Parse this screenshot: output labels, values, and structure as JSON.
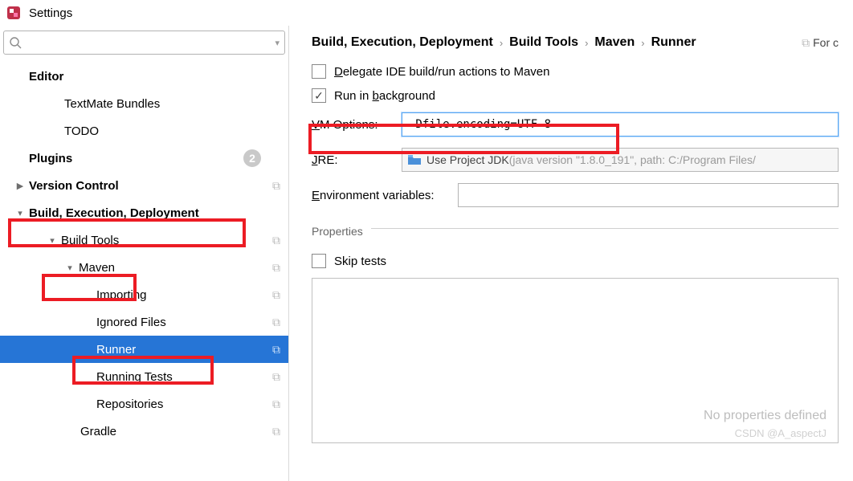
{
  "window": {
    "title": "Settings"
  },
  "search": {
    "placeholder": ""
  },
  "tree": {
    "editor": "Editor",
    "textmate": "TextMate Bundles",
    "todo": "TODO",
    "plugins": "Plugins",
    "plugins_badge": "2",
    "version_control": "Version Control",
    "bed": "Build, Execution, Deployment",
    "build_tools": "Build Tools",
    "maven": "Maven",
    "importing": "Importing",
    "ignored": "Ignored Files",
    "runner": "Runner",
    "running_tests": "Running Tests",
    "repositories": "Repositories",
    "gradle": "Gradle"
  },
  "breadcrumb": {
    "a": "Build, Execution, Deployment",
    "b": "Build Tools",
    "c": "Maven",
    "d": "Runner",
    "trail": "For c"
  },
  "form": {
    "delegate": "elegate IDE build/run actions to Maven",
    "delegate_pre": "D",
    "run_bg_pre": "Run in ",
    "run_bg_u": "b",
    "run_bg_post": "ackground",
    "vm_u": "V",
    "vm_post": "M Options:",
    "vm_value": "-Dfile.encoding=UTF-8",
    "jre_u": "J",
    "jre_post": "RE:",
    "jre_text": "Use Project JDK ",
    "jre_gray": "(java version \"1.8.0_191\", path: C:/Program Files/",
    "env_u": "E",
    "env_post": "nvironment variables:",
    "env_value": "",
    "props_title": "Properties",
    "skip_pre": "S",
    "skip_u": "k",
    "skip_post": "ip tests",
    "empty": "No properties defined"
  },
  "watermark": "CSDN @A_aspectJ"
}
